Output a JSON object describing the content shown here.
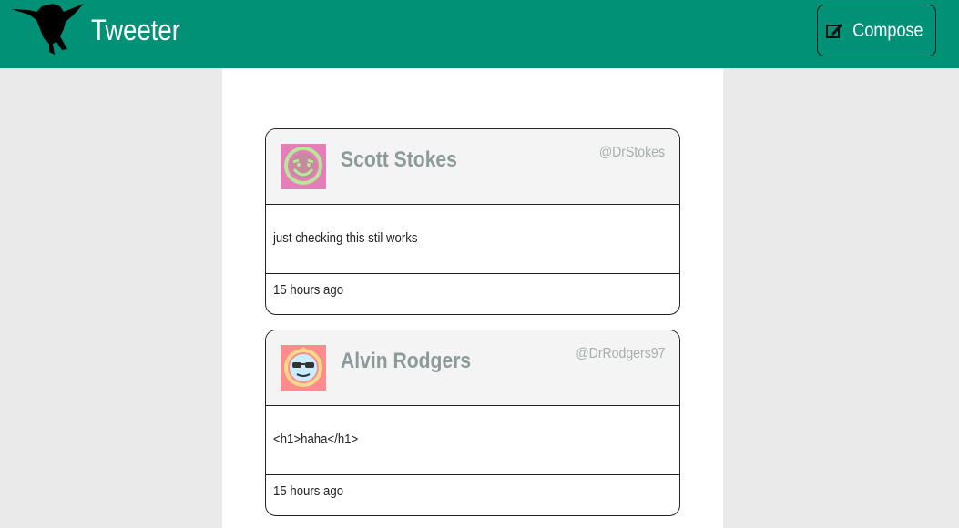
{
  "navbar": {
    "brand": "Tweeter",
    "logo_icon": "hummingbird-icon",
    "compose": {
      "label": "Compose",
      "icon": "pencil-square-icon"
    }
  },
  "tweets": [
    {
      "name": "Scott Stokes",
      "handle": "@DrStokes",
      "text": "just checking this stil works",
      "time": "15 hours ago",
      "avatar": {
        "icon": "smiley-face-icon",
        "bg": "#e47db8",
        "face": "#b8e69a"
      }
    },
    {
      "name": "Alvin Rodgers",
      "handle": "@DrRodgers97",
      "text": "<h1>haha</h1>",
      "time": "15 hours ago",
      "avatar": {
        "icon": "sunglasses-face-icon",
        "bg": "#ff8c8c",
        "face": "#c9ecff"
      }
    }
  ],
  "colors": {
    "header": "#009177",
    "page_bg": "#eaeaea",
    "card_header": "#f4f4f4",
    "name": "#8c9a99",
    "handle": "#a6aeae"
  }
}
